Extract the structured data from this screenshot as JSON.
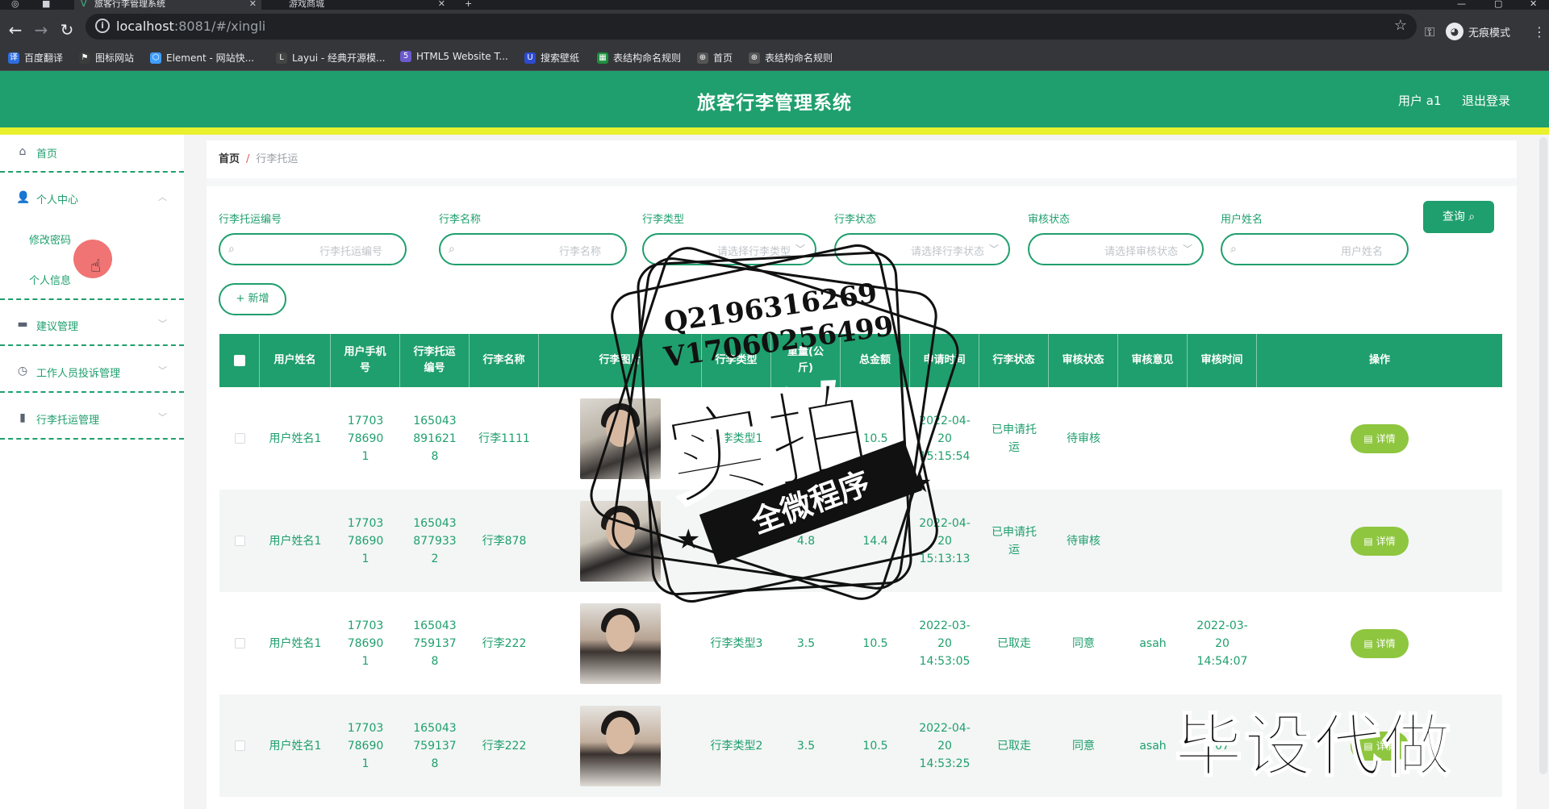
{
  "browser": {
    "tabs": [
      {
        "title": "旅客行李管理系统",
        "active": true
      },
      {
        "title": "游戏商城",
        "active": false
      }
    ],
    "new_tab": "+",
    "url_host": "localhost",
    "url_rest": ":8081/#/xingli",
    "incognito_label": "无痕模式",
    "bookmarks": [
      {
        "label": "百度翻译",
        "icon": "translate-icon",
        "color": "#2d6ee0"
      },
      {
        "label": "图标网站",
        "icon": "flag-icon",
        "color": "#3b3b3b"
      },
      {
        "label": "Element - 网站快...",
        "icon": "hexagon-icon",
        "color": "#409eff"
      },
      {
        "label": "Layui - 经典开源模...",
        "icon": "layui-icon",
        "color": "#444"
      },
      {
        "label": "HTML5 Website T...",
        "icon": "html5-icon",
        "color": "#6a5acd"
      },
      {
        "label": "搜索壁纸",
        "icon": "wallpaper-icon",
        "color": "#2d4bd0"
      },
      {
        "label": "表结构命名规则",
        "icon": "sheet-icon",
        "color": "#1e8e3e"
      },
      {
        "label": "首页",
        "icon": "globe-icon",
        "color": "#555"
      },
      {
        "label": "表结构命名规则",
        "icon": "globe-icon",
        "color": "#555"
      }
    ]
  },
  "header": {
    "title": "旅客行李管理系统",
    "user": "用户 a1",
    "logout": "退出登录"
  },
  "sidebar": {
    "home": "首页",
    "personal_center": "个人中心",
    "change_password": "修改密码",
    "personal_info": "个人信息",
    "suggestion_mgmt": "建议管理",
    "staff_complaint_mgmt": "工作人员投诉管理",
    "luggage_mgmt": "行李托运管理"
  },
  "breadcrumb": {
    "home": "首页",
    "sep": "/",
    "current": "行李托运"
  },
  "filters": [
    {
      "label": "行李托运编号",
      "placeholder": "行李托运编号",
      "dropdown": false
    },
    {
      "label": "行李名称",
      "placeholder": "行李名称",
      "dropdown": false
    },
    {
      "label": "行李类型",
      "placeholder": "请选择行李类型",
      "dropdown": true
    },
    {
      "label": "行李状态",
      "placeholder": "请选择行李状态",
      "dropdown": true
    },
    {
      "label": "审核状态",
      "placeholder": "请选择审核状态",
      "dropdown": true
    },
    {
      "label": "用户姓名",
      "placeholder": "用户姓名",
      "dropdown": false
    }
  ],
  "query_button": "查询",
  "add_button": "+ 新增",
  "table": {
    "headers": [
      "用户姓名",
      "用户手机号",
      "行李托运编号",
      "行李名称",
      "行李图片",
      "行李类型",
      "重量(公斤)",
      "总金额",
      "申请时间",
      "行李状态",
      "审核状态",
      "审核意见",
      "审核时间",
      "操作"
    ],
    "rows": [
      {
        "user": "用户姓名1",
        "phone": "17703786901",
        "no": "1650438916218",
        "name": "行李1111",
        "img": "t1",
        "type": "行李类型1",
        "weight": "3.5",
        "amount": "10.5",
        "time": "2022-04-20 15:15:54",
        "status": "已申请托运",
        "audit": "待审核",
        "opinion": "",
        "audit_time": ""
      },
      {
        "user": "用户姓名1",
        "phone": "17703786901",
        "no": "1650438779332",
        "name": "行李878",
        "img": "t2",
        "type": "行李类型1",
        "weight": "4.8",
        "amount": "14.4",
        "time": "2022-04-20 15:13:13",
        "status": "已申请托运",
        "audit": "待审核",
        "opinion": "",
        "audit_time": ""
      },
      {
        "user": "用户姓名1",
        "phone": "17703786901",
        "no": "1650437591378",
        "name": "行李222",
        "img": "t3",
        "type": "行李类型3",
        "weight": "3.5",
        "amount": "10.5",
        "time": "2022-03-20 14:53:05",
        "status": "已取走",
        "audit": "同意",
        "opinion": "asah",
        "audit_time": "2022-03-20 14:54:07"
      },
      {
        "user": "用户姓名1",
        "phone": "17703786901",
        "no": "1650437591378",
        "name": "行李222",
        "img": "t4",
        "type": "行李类型2",
        "weight": "3.5",
        "amount": "10.5",
        "time": "2022-04-20 14:53:25",
        "status": "已取走",
        "audit": "同意",
        "opinion": "asah",
        "audit_time": "07"
      }
    ],
    "detail_button": "详情"
  },
  "watermark": {
    "qq": "Q2196316269",
    "v": "V17060256499",
    "big": "实拍",
    "band": "全微程序",
    "bottom": "毕设代做"
  }
}
